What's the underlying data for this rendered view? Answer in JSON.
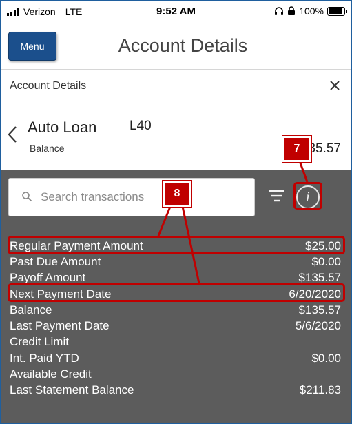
{
  "status_bar": {
    "carrier": "Verizon",
    "network": "LTE",
    "time": "9:52 AM",
    "battery": "100%",
    "battery_level": 1.0
  },
  "header": {
    "menu_label": "Menu",
    "title": "Account Details"
  },
  "panel": {
    "title": "Account Details"
  },
  "account": {
    "name": "Auto Loan",
    "code": "L40",
    "sub_label": "Balance",
    "balance": "35.57"
  },
  "search": {
    "placeholder": "Search transactions"
  },
  "details": [
    {
      "label": "Regular Payment Amount",
      "value": "$25.00"
    },
    {
      "label": "Past Due Amount",
      "value": "$0.00"
    },
    {
      "label": "Payoff Amount",
      "value": "$135.57"
    },
    {
      "label": "Next Payment Date",
      "value": "6/20/2020"
    },
    {
      "label": "Balance",
      "value": "$135.57"
    },
    {
      "label": "Last Payment Date",
      "value": "5/6/2020"
    },
    {
      "label": "Credit Limit",
      "value": ""
    },
    {
      "label": "Int. Paid YTD",
      "value": "$0.00"
    },
    {
      "label": "Available Credit",
      "value": ""
    },
    {
      "label": "Last Statement Balance",
      "value": "$211.83"
    }
  ],
  "callouts": {
    "seven": "7",
    "eight": "8"
  },
  "colors": {
    "accent": "#1b4f8c",
    "dark_panel": "#5c5c5c",
    "callout_red": "#c00000",
    "frame_border": "#1f5f9e"
  },
  "icons": {
    "close": "close-icon",
    "back": "chevron-left-icon",
    "search": "search-icon",
    "filter": "filter-icon",
    "info": "info-icon"
  }
}
